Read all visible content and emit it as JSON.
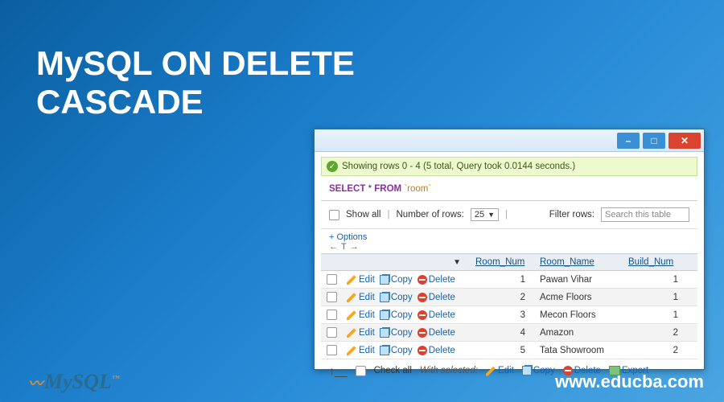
{
  "page": {
    "title_line1": "MySQL ON DELETE",
    "title_line2": "CASCADE",
    "footer_url": "www.educba.com",
    "logo_text": "MySQL",
    "logo_tm": "™"
  },
  "window": {
    "buttons": {
      "min": "–",
      "max": "□",
      "close": "✕"
    }
  },
  "status": {
    "icon": "check-icon",
    "text": "Showing rows 0 - 4 (5 total, Query took 0.0144 seconds.)"
  },
  "sql": {
    "select": "SELECT",
    "star": "*",
    "from": "FROM",
    "table": "`room`"
  },
  "filters": {
    "show_all_label": "Show all",
    "num_rows_label": "Number of rows:",
    "num_rows_value": "25",
    "filter_label": "Filter rows:",
    "search_placeholder": "Search this table"
  },
  "options_label": "+ Options",
  "sort_arrows": {
    "left": "←",
    "t": "T",
    "right": "→"
  },
  "columns": {
    "room_num": "Room_Num",
    "room_name": "Room_Name",
    "build_num": "Build_Num"
  },
  "actions": {
    "edit": "Edit",
    "copy": "Copy",
    "delete": "Delete"
  },
  "rows": [
    {
      "num": "1",
      "name": "Pawan Vihar",
      "build": "1"
    },
    {
      "num": "2",
      "name": "Acme Floors",
      "build": "1"
    },
    {
      "num": "3",
      "name": "Mecon Floors",
      "build": "1"
    },
    {
      "num": "4",
      "name": "Amazon",
      "build": "2"
    },
    {
      "num": "5",
      "name": "Tata Showroom",
      "build": "2"
    }
  ],
  "footer_actions": {
    "up_arrow": "↑__",
    "check_all": "Check all",
    "with_selected": "With selected:",
    "edit": "Edit",
    "copy": "Copy",
    "delete": "Delete",
    "export": "Export"
  }
}
